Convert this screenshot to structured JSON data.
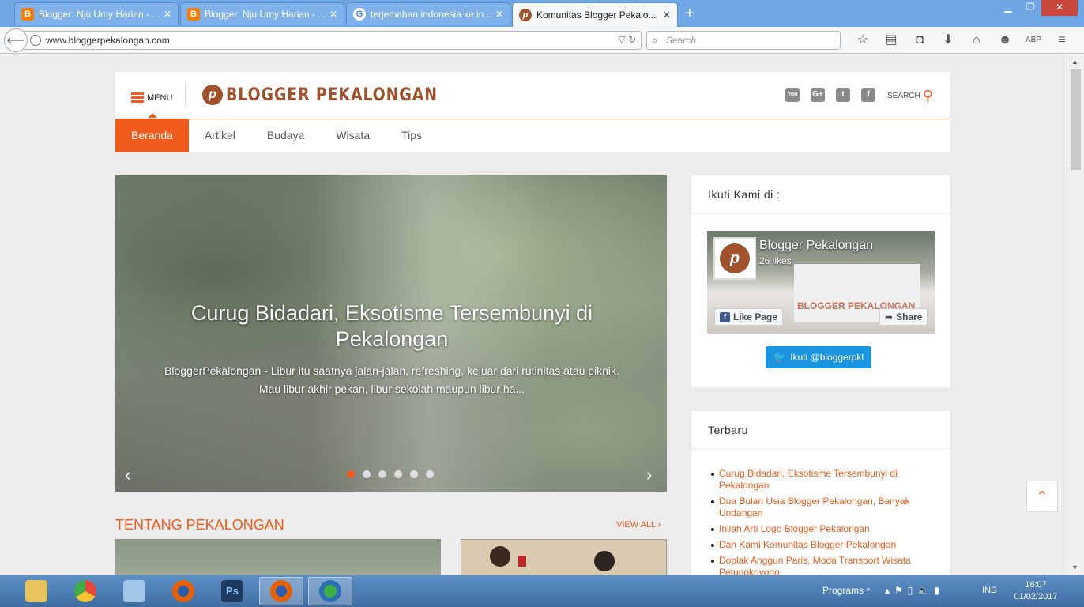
{
  "browser": {
    "tabs": [
      {
        "label": "Blogger: Nju Umy Harian - ...",
        "favicon_color": "#f57d00",
        "glyph": "B"
      },
      {
        "label": "Blogger: Nju Umy Harian - ...",
        "favicon_color": "#f57d00",
        "glyph": "B"
      },
      {
        "label": "terjemahan indonesia ke in...",
        "favicon_color": "#ffffff",
        "glyph": "G"
      },
      {
        "label": "Komunitas Blogger Pekalo...",
        "favicon_color": "#a0522d",
        "glyph": "p"
      }
    ],
    "new_tab": "+",
    "url": "www.bloggerpekalongan.com",
    "search_placeholder": "Search",
    "toolbar_icons": [
      "star-icon",
      "reading-list-icon",
      "pocket-icon",
      "download-icon",
      "home-icon",
      "chat-icon",
      "adblock-icon",
      "hamburger-icon"
    ]
  },
  "site": {
    "menu_label": "MENU",
    "logo_text": "BLOGGER PEKALONGAN",
    "logo_glyph": "p",
    "social": [
      {
        "name": "youtube-icon",
        "glyph": "You"
      },
      {
        "name": "google-plus-icon",
        "glyph": "G+"
      },
      {
        "name": "twitter-icon",
        "glyph": "t"
      },
      {
        "name": "facebook-icon",
        "glyph": "f"
      }
    ],
    "search_label": "SEARCH",
    "nav": [
      "Beranda",
      "Artikel",
      "Budaya",
      "Wisata",
      "Tips"
    ]
  },
  "slider": {
    "title": "Curug Bidadari, Eksotisme Tersembunyi di Pekalongan",
    "description": "BloggerPekalongan - Libur itu saatnya jalan-jalan, refreshing, keluar dari rutinitas atau piknik. Mau libur akhir pekan, libur sekolah maupun libur ha...",
    "dots": 6,
    "active_dot": 1
  },
  "section": {
    "title": "TENTANG PEKALONGAN",
    "view_all": "VIEW ALL"
  },
  "sidebar": {
    "follow_title": "Ikuti Kami di :",
    "fb_page_name": "Blogger Pekalongan",
    "fb_likes": "26 likes",
    "fb_like_btn": "Like Page",
    "fb_share_btn": "Share",
    "twitter_btn": "Ikuti @bloggerpkl",
    "recent_title": "Terbaru",
    "recent_posts": [
      "Curug Bidadari, Eksotisme Tersembunyi di Pekalongan",
      "Dua Bulan Usia Blogger Pekalongan, Banyak Undangan",
      "Inilah Arti Logo Blogger Pekalongan",
      "Dan Kami Komunitas Blogger Pekalongan",
      "Doplak Anggun Paris, Moda Transport Wisata Petungkriyono"
    ]
  },
  "taskbar": {
    "programs_label": "Programs",
    "lang": "IND",
    "time": "18:07",
    "date": "01/02/2017",
    "apps": [
      {
        "name": "file-explorer-icon",
        "color": "#e8c25a"
      },
      {
        "name": "chrome-icon",
        "color": "#e8453c"
      },
      {
        "name": "notepad-icon",
        "color": "#9fc7e8"
      },
      {
        "name": "firefox-icon",
        "color": "#e66000"
      },
      {
        "name": "photoshop-icon",
        "color": "#1e3a5f"
      },
      {
        "name": "firefox-icon",
        "color": "#e66000"
      },
      {
        "name": "internet-download-manager-icon",
        "color": "#3fae49"
      }
    ]
  }
}
